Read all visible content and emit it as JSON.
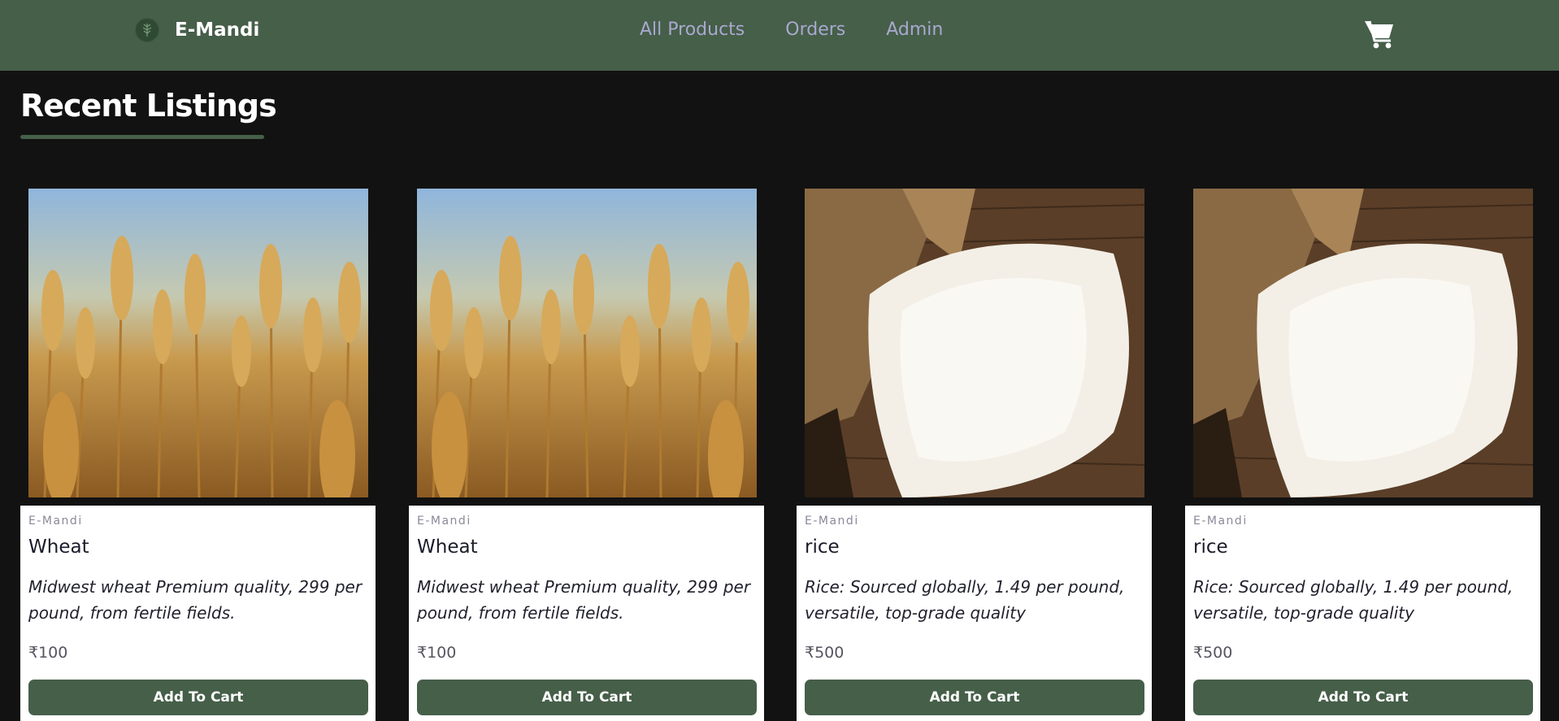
{
  "navbar": {
    "brand": "E-Mandi",
    "links": [
      "All Products",
      "Orders",
      "Admin"
    ],
    "link_color": "#a9a8cf",
    "background": "#465f49",
    "cart_icon": "cart-icon"
  },
  "section": {
    "title": "Recent Listings"
  },
  "products": [
    {
      "brand": "E-Mandi",
      "title": "Wheat",
      "description": "Midwest wheat Premium quality, 299 per pound, from fertile fields.",
      "price": "₹100",
      "button": "Add To Cart",
      "image": "wheat-field-image"
    },
    {
      "brand": "E-Mandi",
      "title": "Wheat",
      "description": "Midwest wheat Premium quality, 299 per pound, from fertile fields.",
      "price": "₹100",
      "button": "Add To Cart",
      "image": "wheat-field-image"
    },
    {
      "brand": "E-Mandi",
      "title": "rice",
      "description": "Rice: Sourced globally, 1.49 per pound, versatile, top-grade quality",
      "price": "₹500",
      "button": "Add To Cart",
      "image": "rice-sack-image"
    },
    {
      "brand": "E-Mandi",
      "title": "rice",
      "description": "Rice: Sourced globally, 1.49 per pound, versatile, top-grade quality",
      "price": "₹500",
      "button": "Add To Cart",
      "image": "rice-sack-image"
    }
  ]
}
